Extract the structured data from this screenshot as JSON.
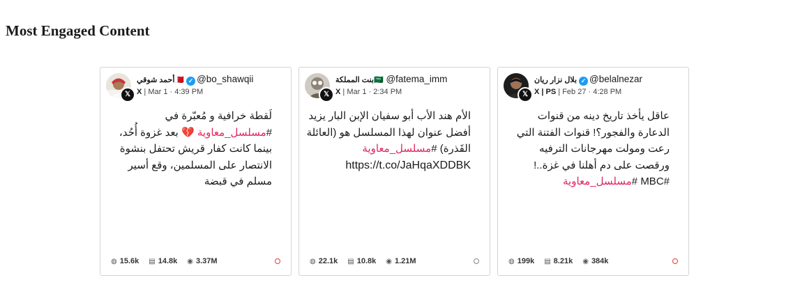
{
  "page": {
    "title": "Most Engaged Content"
  },
  "posts": [
    {
      "display_name": "أحمد شوقي🇧🇭",
      "handle": "@bo_shawqii",
      "source": "X",
      "date": "Mar 1",
      "time": "4:39 PM",
      "body_before": "لَقطة خرافية و مُعبّرة في #",
      "hashtag": "مسلسل_معاوية",
      "body_after": " 💔 بعد غزوة أُحُد، بينما كانت كفار قريش تحتفل بنشوة الانتصار على المسلمين، وقع أسير مسلم في قبضة",
      "link": "",
      "stats": {
        "shares": "15.6k",
        "comments": "14.8k",
        "views": "3.37M"
      },
      "status_color": "#e53935"
    },
    {
      "display_name": "بنت المملكة🇸🇦",
      "handle": "@fatema_imm",
      "source": "X",
      "date": "Mar 1",
      "time": "2:34 PM",
      "body_before": "الأم هند الأب أبو سفيان الإبن البار يزيد أفضل عنوان لهذا المسلسل هو (العائلة القَذرة) #",
      "hashtag": "مسلسل_معاوية",
      "body_after": "",
      "link": "https://t.co/JaHqaXDDBK",
      "stats": {
        "shares": "22.1k",
        "comments": "10.8k",
        "views": "1.21M"
      },
      "status_color": "#888888"
    },
    {
      "display_name": "بلال نزار ريان",
      "handle": "@belalnezar",
      "source": "X | PS",
      "date": "Feb 27",
      "time": "4:28 PM",
      "body_before": "عاقل يأخذ تاريخ دينه من قنوات الدعارة والفجور؟! قنوات الفتنة التي رعت ومولت مهرجانات الترفيه ورقصت على دم أهلنا في غزة..! #MBC #",
      "hashtag": "مسلسل_معاوية",
      "body_after": "",
      "link": "",
      "stats": {
        "shares": "199k",
        "comments": "8.21k",
        "views": "384k"
      },
      "status_color": "#e53935"
    }
  ]
}
